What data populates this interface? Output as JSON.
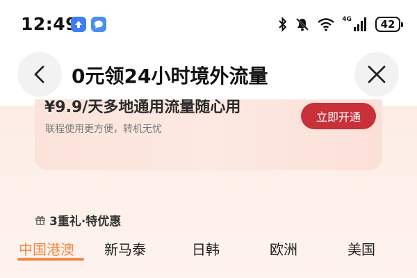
{
  "status_bar": {
    "time": "12:49",
    "network_label": "4G",
    "battery_level": "42",
    "icons": [
      "upload-app-icon",
      "message-app-icon",
      "bluetooth-icon",
      "mute-icon",
      "wifi-icon",
      "signal-icon",
      "battery-icon"
    ]
  },
  "header": {
    "title": "0元领24小时境外流量",
    "back_icon": "chevron-left-icon",
    "close_icon": "close-icon"
  },
  "promo": {
    "headline": "¥9.9/天多地通用流量随心用",
    "subtext": "联程使用更方便，转机无忧",
    "button_label": "立即开通",
    "button_color": "#c8303a"
  },
  "offers": {
    "icon": "gift-icon",
    "label": "3重礼·特优惠"
  },
  "tabs": {
    "items": [
      {
        "label": "中国港澳"
      },
      {
        "label": "新马泰"
      },
      {
        "label": "日韩"
      },
      {
        "label": "欧洲"
      },
      {
        "label": "美国"
      }
    ],
    "active_index": 0,
    "accent_color": "#f08a4b"
  }
}
